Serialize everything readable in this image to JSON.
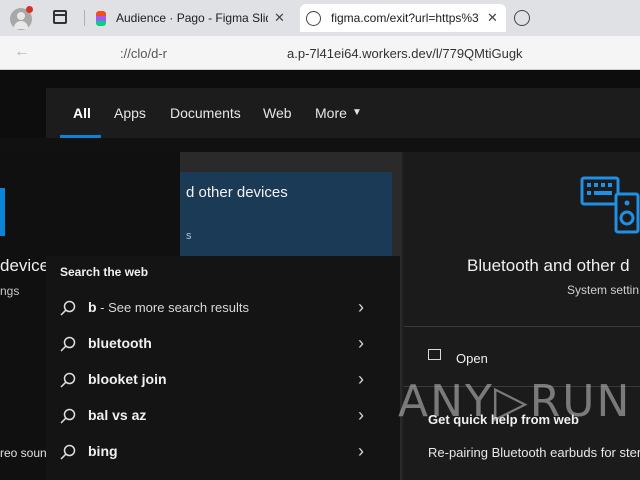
{
  "browser": {
    "tabs": [
      {
        "title": "Audience · Pago - Figma Slid"
      },
      {
        "title": "figma.com/exit?url=https%3"
      }
    ],
    "address_url": "a.p-7l41ei64.workers.dev/l/779QMtiGugk",
    "address_prefix": "://clo/d-r"
  },
  "search_nav": {
    "tabs": [
      "All",
      "Apps",
      "Documents",
      "Web",
      "More"
    ]
  },
  "left_panel": {
    "title": "devices settings",
    "subtitle": "ngs",
    "bottom_text": "reo sound"
  },
  "mid_panel": {
    "heading": "d other devices",
    "sub": "s"
  },
  "suggestions": {
    "header": "Search the web",
    "items": [
      {
        "query": "b",
        "suffix": " - See more search results"
      },
      {
        "query": "bluetooth",
        "suffix": ""
      },
      {
        "query": "blooket join",
        "suffix": ""
      },
      {
        "query": "bal vs az",
        "suffix": ""
      },
      {
        "query": "bing",
        "suffix": ""
      }
    ]
  },
  "right_panel": {
    "title": "Bluetooth and other d",
    "subtitle": "System settin",
    "open_label": "Open",
    "help_header": "Get quick help from web",
    "help_item": "Re-pairing Bluetooth earbuds for ster"
  },
  "watermark": "ANY▷RUN",
  "colors": {
    "accent": "#0a84d6",
    "highlight": "#1b3a55"
  }
}
